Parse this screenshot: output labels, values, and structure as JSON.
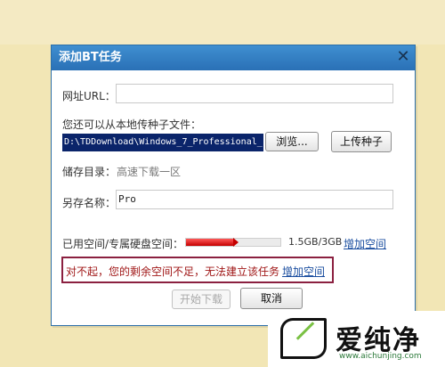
{
  "dialog": {
    "title": "添加BT任务",
    "close_glyph": "✕",
    "url_label": "网址URL：",
    "url_value": "",
    "local_seed_label": "您还可以从本地传种子文件：",
    "local_path_value": "D:\\TDDownload\\Windows_7_Professional_",
    "browse_label": "浏览...",
    "upload_label": "上传种子",
    "storage_label": "储存目录：",
    "storage_value": "高速下载一区",
    "saveas_label": "另存名称：",
    "saveas_value": "Pro",
    "space_label": "已用空间/专属硬盘空间：",
    "space_usage": "1.5GB/3GB",
    "space_used_fraction": 0.5,
    "add_space_label": "增加空间",
    "warning_text": "对不起，您的剩余空间不足，无法建立该任务",
    "warning_link": "增加空间",
    "start_label": "开始下载",
    "cancel_label": "取消"
  },
  "watermark": {
    "brand": "爱纯净",
    "url": "www.aichunjing.com"
  },
  "colors": {
    "background": "#f2e6b5",
    "titlebar": "#2a70b6",
    "bar_fill": "#c40000",
    "warning_border": "#8b2040",
    "link": "#1c4fa0"
  }
}
